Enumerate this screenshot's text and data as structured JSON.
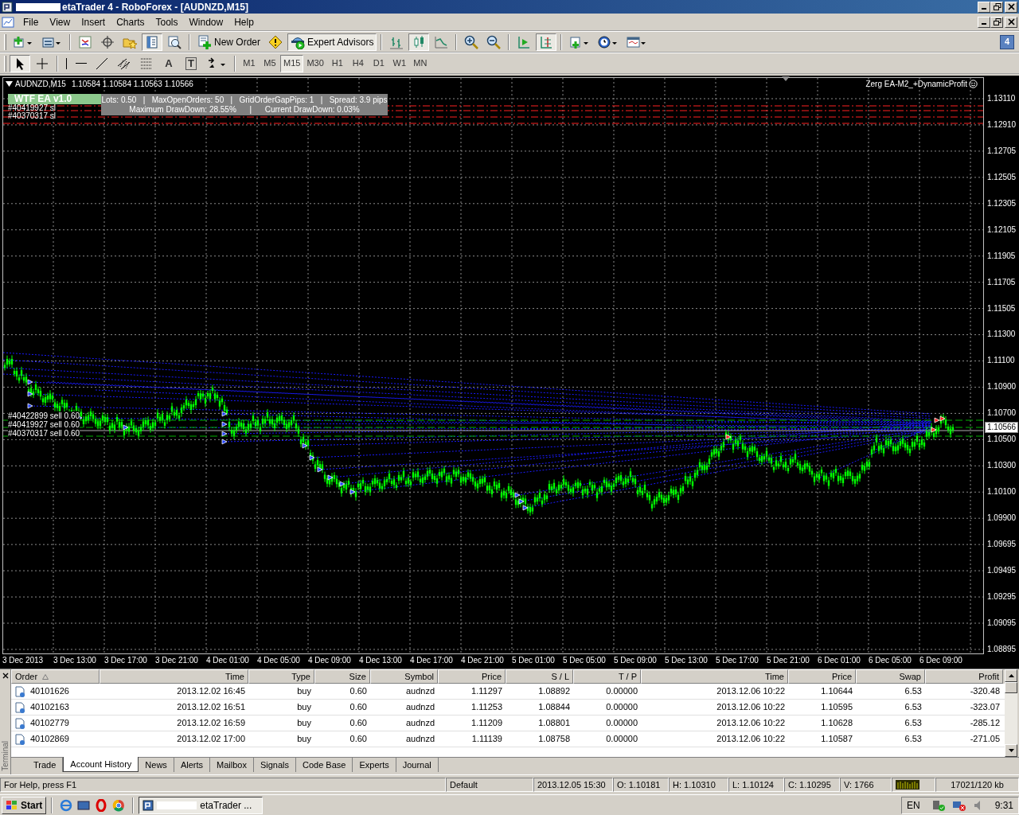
{
  "window": {
    "title": "etaTrader 4 - RoboForex - [AUDNZD,M15]"
  },
  "menu": [
    "File",
    "View",
    "Insert",
    "Charts",
    "Tools",
    "Window",
    "Help"
  ],
  "mail_badge": "4",
  "toolbar_main": [
    {
      "kind": "icon",
      "on": false
    },
    {
      "kind": "icon",
      "on": false
    },
    {
      "kind": "separator"
    },
    {
      "kind": "icon",
      "on": false
    },
    {
      "kind": "icon",
      "on": false
    },
    {
      "kind": "icon",
      "on": false
    },
    {
      "kind": "icon",
      "on": true
    },
    {
      "kind": "icon",
      "on": false
    },
    {
      "kind": "separator"
    },
    {
      "kind": "button",
      "label": "New Order",
      "on": false
    },
    {
      "kind": "icon",
      "on": false
    },
    {
      "kind": "button",
      "label": "Expert Advisors",
      "on": true
    },
    {
      "kind": "separator"
    },
    {
      "kind": "icon",
      "on": false
    },
    {
      "kind": "icon",
      "on": true
    },
    {
      "kind": "icon",
      "on": false
    },
    {
      "kind": "separator"
    },
    {
      "kind": "icon",
      "on": false
    },
    {
      "kind": "icon",
      "on": false
    },
    {
      "kind": "separator"
    },
    {
      "kind": "icon",
      "on": false
    },
    {
      "kind": "icon",
      "on": true
    },
    {
      "kind": "separator"
    },
    {
      "kind": "icon",
      "on": false
    },
    {
      "kind": "icon",
      "on": false
    },
    {
      "kind": "icon",
      "on": false
    }
  ],
  "toolbar_draw": [
    {
      "kind": "icon",
      "on": true
    },
    {
      "kind": "icon",
      "on": false
    },
    {
      "kind": "separator"
    },
    {
      "kind": "icon",
      "on": false
    },
    {
      "kind": "icon",
      "on": false
    },
    {
      "kind": "icon",
      "on": false
    },
    {
      "kind": "icon",
      "on": false
    },
    {
      "kind": "icon",
      "on": false
    },
    {
      "kind": "glyph",
      "label": "A",
      "on": false
    },
    {
      "kind": "glyph",
      "label": "T",
      "on": false
    },
    {
      "kind": "icon",
      "on": false
    }
  ],
  "timeframes": [
    {
      "label": "M1",
      "selected": false
    },
    {
      "label": "M5",
      "selected": false
    },
    {
      "label": "M15",
      "selected": true
    },
    {
      "label": "M30",
      "selected": false
    },
    {
      "label": "H1",
      "selected": false
    },
    {
      "label": "H4",
      "selected": false
    },
    {
      "label": "D1",
      "selected": false
    },
    {
      "label": "W1",
      "selected": false
    },
    {
      "label": "MN",
      "selected": false
    }
  ],
  "chart": {
    "symbol": "AUDNZD,M15",
    "ohlc": "1.10584 1.10584 1.10563 1.10566",
    "ea_name": "Zerg EA-M2_+DynamicProfit",
    "panel": {
      "title": "WTF EA v1.0",
      "line_1": "Lots: 0.50   |   MaxOpenOrders: 50   |   GridOrderGapPips: 1   |   Spread: 3.9 pips",
      "line_2": "Maximum DrawDown: 28.55%      |      Current DrawDown: 0.03%"
    },
    "sl_labels": [
      "#40419927 sl",
      "#40370317 sl"
    ],
    "order_labels": [
      "#40422899 sell 0.60",
      "#40419927 sell 0.60",
      "#40370317 sell 0.60"
    ],
    "price_axis": [
      "1.13110",
      "1.12910",
      "1.12705",
      "1.12505",
      "1.12305",
      "1.12105",
      "1.11905",
      "1.11705",
      "1.11505",
      "1.11300",
      "1.11100",
      "1.10900",
      "1.10700",
      "1.10500",
      "1.10300",
      "1.10100",
      "1.09900",
      "1.09695",
      "1.09495",
      "1.09295",
      "1.09095",
      "1.08895"
    ],
    "current_price": "1.10566",
    "time_axis": [
      "3 Dec 2013",
      "3 Dec 13:00",
      "3 Dec 17:00",
      "3 Dec 21:00",
      "4 Dec 01:00",
      "4 Dec 05:00",
      "4 Dec 09:00",
      "4 Dec 13:00",
      "4 Dec 17:00",
      "4 Dec 21:00",
      "5 Dec 01:00",
      "5 Dec 05:00",
      "5 Dec 09:00",
      "5 Dec 13:00",
      "5 Dec 17:00",
      "5 Dec 21:00",
      "6 Dec 01:00",
      "6 Dec 05:00",
      "6 Dec 09:00"
    ]
  },
  "terminal": {
    "label": "Terminal",
    "columns": [
      "Order",
      "Time",
      "Type",
      "Size",
      "Symbol",
      "Price",
      "S / L",
      "T / P",
      "Time",
      "Price",
      "Swap",
      "Profit"
    ],
    "rows": [
      [
        "40101626",
        "2013.12.02 16:45",
        "buy",
        "0.60",
        "audnzd",
        "1.11297",
        "1.08892",
        "0.00000",
        "2013.12.06 10:22",
        "1.10644",
        "6.53",
        "-320.48"
      ],
      [
        "40102163",
        "2013.12.02 16:51",
        "buy",
        "0.60",
        "audnzd",
        "1.11253",
        "1.08844",
        "0.00000",
        "2013.12.06 10:22",
        "1.10595",
        "6.53",
        "-323.07"
      ],
      [
        "40102779",
        "2013.12.02 16:59",
        "buy",
        "0.60",
        "audnzd",
        "1.11209",
        "1.08801",
        "0.00000",
        "2013.12.06 10:22",
        "1.10628",
        "6.53",
        "-285.12"
      ],
      [
        "40102869",
        "2013.12.02 17:00",
        "buy",
        "0.60",
        "audnzd",
        "1.11139",
        "1.08758",
        "0.00000",
        "2013.12.06 10:22",
        "1.10587",
        "6.53",
        "-271.05"
      ]
    ],
    "tabs": [
      {
        "label": "Trade",
        "selected": false
      },
      {
        "label": "Account History",
        "selected": true
      },
      {
        "label": "News",
        "selected": false
      },
      {
        "label": "Alerts",
        "selected": false
      },
      {
        "label": "Mailbox",
        "selected": false
      },
      {
        "label": "Signals",
        "selected": false
      },
      {
        "label": "Code Base",
        "selected": false
      },
      {
        "label": "Experts",
        "selected": false
      },
      {
        "label": "Journal",
        "selected": false
      }
    ]
  },
  "status_bar": {
    "help": "For Help, press F1",
    "profile": "Default",
    "time": "2013.12.05 15:30",
    "open": "O: 1.10181",
    "high": "H: 1.10310",
    "low": "L: 1.10124",
    "close": "C: 1.10295",
    "volume": "V: 1766",
    "traffic": "17021/120 kb"
  },
  "taskbar": {
    "start": "Start",
    "task": "etaTrader ...",
    "language": "EN",
    "clock": "9:31"
  }
}
